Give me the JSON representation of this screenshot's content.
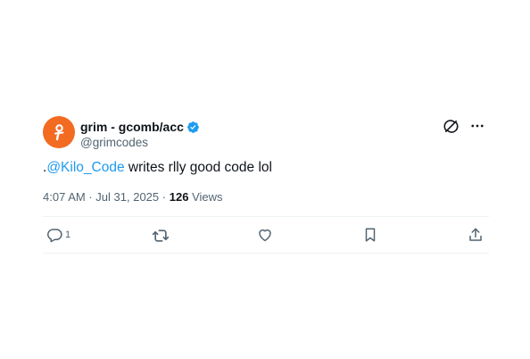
{
  "author": {
    "display_name": "grim - gcomb/acc",
    "handle": "@grimcodes",
    "verified": true,
    "avatar_color": "#f26b21"
  },
  "tweet": {
    "prefix": ".",
    "mention": "@Kilo_Code",
    "text_after_mention": " writes rlly good code lol"
  },
  "meta": {
    "time": "4:07 AM",
    "separator": "·",
    "date": "Jul 31, 2025",
    "views_count": "126",
    "views_label": "Views"
  },
  "actions": {
    "reply_count": "1"
  },
  "icons": {
    "grok": "grok-icon",
    "more": "more-icon",
    "reply": "reply-icon",
    "retweet": "retweet-icon",
    "like": "like-icon",
    "bookmark": "bookmark-icon",
    "share": "share-icon",
    "verified": "verified-badge-icon"
  },
  "colors": {
    "link": "#1d9bf0",
    "secondary_text": "#536471",
    "primary_text": "#0f1419"
  }
}
